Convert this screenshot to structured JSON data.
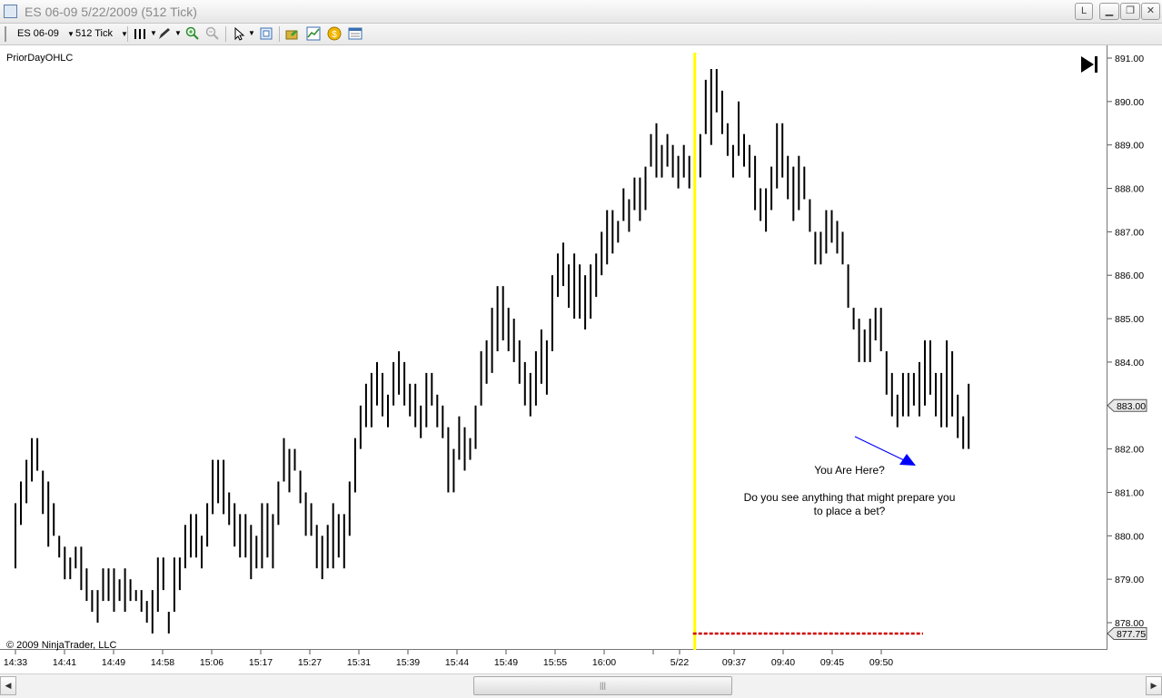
{
  "window": {
    "title": "ES 06-09  5/22/2009 (512 Tick)",
    "buttons": {
      "layout": "L",
      "minimize": "▁",
      "restore": "❐",
      "close": "✕"
    }
  },
  "toolbar": {
    "instrument": "ES 06-09",
    "interval": "512 Tick",
    "icons": [
      "bars-style-icon",
      "drawing-pencil-icon",
      "zoom-in-icon",
      "zoom-out-icon",
      "pointer-cursor-icon",
      "chart-properties-icon",
      "instrument-folder-icon",
      "indicators-icon",
      "strategies-icon",
      "data-box-icon"
    ]
  },
  "chart": {
    "indicator_label": "PriorDayOHLC",
    "copyright": "© 2009 NinjaTrader, LLC",
    "annotation_question": "You Are Here?",
    "annotation_line1": "Do you see anything that might prepare you",
    "annotation_line2": "to place a bet?",
    "last_price_label": "883.00",
    "prior_low_label": "877.75",
    "colors": {
      "bars": "#000000",
      "session_line": "#ffff00",
      "prior_low_line": "#cc0000",
      "arrow": "#0000ff"
    }
  },
  "chart_data": {
    "type": "ohlc-bars",
    "y_axis": {
      "min": 877.75,
      "max": 891.0,
      "ticks": [
        "878.00",
        "879.00",
        "880.00",
        "881.00",
        "882.00",
        "883.00",
        "884.00",
        "885.00",
        "886.00",
        "887.00",
        "888.00",
        "889.00",
        "890.00",
        "891.00"
      ]
    },
    "x_ticks": [
      "14:33",
      "14:41",
      "14:49",
      "14:58",
      "15:06",
      "15:17",
      "15:27",
      "15:31",
      "15:39",
      "15:44",
      "15:49",
      "15:55",
      "16:00",
      "5/22",
      "09:37",
      "09:40",
      "09:45",
      "09:50"
    ],
    "session_break_bar_index": 124,
    "prior_low": 877.75,
    "last_price": 883.0,
    "bars": [
      [
        879.25,
        880.75
      ],
      [
        880.25,
        881.25
      ],
      [
        880.75,
        881.75
      ],
      [
        881.25,
        882.25
      ],
      [
        881.5,
        882.25
      ],
      [
        880.5,
        881.5
      ],
      [
        879.75,
        881.25
      ],
      [
        880.0,
        880.75
      ],
      [
        879.5,
        880.0
      ],
      [
        879.0,
        879.75
      ],
      [
        879.0,
        879.5
      ],
      [
        879.25,
        879.75
      ],
      [
        878.75,
        879.75
      ],
      [
        878.5,
        879.25
      ],
      [
        878.25,
        878.75
      ],
      [
        878.0,
        878.75
      ],
      [
        878.5,
        879.25
      ],
      [
        878.5,
        879.25
      ],
      [
        878.25,
        879.25
      ],
      [
        878.5,
        879.0
      ],
      [
        878.25,
        879.25
      ],
      [
        878.5,
        879.0
      ],
      [
        878.5,
        878.75
      ],
      [
        878.25,
        878.75
      ],
      [
        878.0,
        878.5
      ],
      [
        877.75,
        878.75
      ],
      [
        878.25,
        879.5
      ],
      [
        878.75,
        879.5
      ],
      [
        877.75,
        878.25
      ],
      [
        878.25,
        879.5
      ],
      [
        878.75,
        879.5
      ],
      [
        879.25,
        880.25
      ],
      [
        879.5,
        880.5
      ],
      [
        879.5,
        880.5
      ],
      [
        879.25,
        880.0
      ],
      [
        879.75,
        880.75
      ],
      [
        880.5,
        881.75
      ],
      [
        880.75,
        881.75
      ],
      [
        880.5,
        881.75
      ],
      [
        880.25,
        881.0
      ],
      [
        879.75,
        880.75
      ],
      [
        879.5,
        880.5
      ],
      [
        879.5,
        880.5
      ],
      [
        879.0,
        880.25
      ],
      [
        879.25,
        880.0
      ],
      [
        879.25,
        880.75
      ],
      [
        879.5,
        880.75
      ],
      [
        879.25,
        880.5
      ],
      [
        880.25,
        881.25
      ],
      [
        881.25,
        882.25
      ],
      [
        881.0,
        882.0
      ],
      [
        881.5,
        882.0
      ],
      [
        880.75,
        881.5
      ],
      [
        880.0,
        881.0
      ],
      [
        880.0,
        880.75
      ],
      [
        879.25,
        880.25
      ],
      [
        879.0,
        880.0
      ],
      [
        879.25,
        880.25
      ],
      [
        879.25,
        880.75
      ],
      [
        879.5,
        880.5
      ],
      [
        879.25,
        880.5
      ],
      [
        880.0,
        881.25
      ],
      [
        881.0,
        882.25
      ],
      [
        882.0,
        883.0
      ],
      [
        882.5,
        883.5
      ],
      [
        882.5,
        883.75
      ],
      [
        883.0,
        884.0
      ],
      [
        882.75,
        883.75
      ],
      [
        882.5,
        883.25
      ],
      [
        883.0,
        884.0
      ],
      [
        883.25,
        884.25
      ],
      [
        883.0,
        884.0
      ],
      [
        882.75,
        883.5
      ],
      [
        882.5,
        883.5
      ],
      [
        882.25,
        883.0
      ],
      [
        882.5,
        883.75
      ],
      [
        883.0,
        883.75
      ],
      [
        882.5,
        883.25
      ],
      [
        882.25,
        883.0
      ],
      [
        881.0,
        882.5
      ],
      [
        881.0,
        882.0
      ],
      [
        881.75,
        882.75
      ],
      [
        881.5,
        882.5
      ],
      [
        881.75,
        882.25
      ],
      [
        882.0,
        883.0
      ],
      [
        883.0,
        884.25
      ],
      [
        883.5,
        884.5
      ],
      [
        883.75,
        885.25
      ],
      [
        884.25,
        885.75
      ],
      [
        884.5,
        885.75
      ],
      [
        884.25,
        885.25
      ],
      [
        884.0,
        885.0
      ],
      [
        883.5,
        884.5
      ],
      [
        883.0,
        884.0
      ],
      [
        882.75,
        883.75
      ],
      [
        883.0,
        884.25
      ],
      [
        883.5,
        884.75
      ],
      [
        883.25,
        884.5
      ],
      [
        884.25,
        886.0
      ],
      [
        885.5,
        886.5
      ],
      [
        885.75,
        886.75
      ],
      [
        885.25,
        886.25
      ],
      [
        885.0,
        886.5
      ],
      [
        885.0,
        886.25
      ],
      [
        884.75,
        886.0
      ],
      [
        885.0,
        886.25
      ],
      [
        885.5,
        886.5
      ],
      [
        886.0,
        887.0
      ],
      [
        886.25,
        887.5
      ],
      [
        886.5,
        887.5
      ],
      [
        886.75,
        887.25
      ],
      [
        887.25,
        888.0
      ],
      [
        887.0,
        887.75
      ],
      [
        887.5,
        888.25
      ],
      [
        887.25,
        888.25
      ],
      [
        887.5,
        888.5
      ],
      [
        888.5,
        889.25
      ],
      [
        888.25,
        889.5
      ],
      [
        888.25,
        889.0
      ],
      [
        888.5,
        889.25
      ],
      [
        888.25,
        889.0
      ],
      [
        888.0,
        888.75
      ],
      [
        888.25,
        889.0
      ],
      [
        888.0,
        888.75
      ],
      [
        888.5,
        889.0
      ],
      [
        888.25,
        889.25
      ],
      [
        889.25,
        890.5
      ],
      [
        889.0,
        890.75
      ],
      [
        889.75,
        890.75
      ],
      [
        889.25,
        890.25
      ],
      [
        888.75,
        889.5
      ],
      [
        888.25,
        889.0
      ],
      [
        888.75,
        890.0
      ],
      [
        888.5,
        889.25
      ],
      [
        888.25,
        889.0
      ],
      [
        887.5,
        888.75
      ],
      [
        887.25,
        888.0
      ],
      [
        887.0,
        888.0
      ],
      [
        887.5,
        888.5
      ],
      [
        888.0,
        889.5
      ],
      [
        888.25,
        889.5
      ],
      [
        887.75,
        888.75
      ],
      [
        887.25,
        888.5
      ],
      [
        887.5,
        888.75
      ],
      [
        887.75,
        888.5
      ],
      [
        887.0,
        887.75
      ],
      [
        886.25,
        887.0
      ],
      [
        886.25,
        887.0
      ],
      [
        886.5,
        887.5
      ],
      [
        886.75,
        887.5
      ],
      [
        886.5,
        887.25
      ],
      [
        886.25,
        887.0
      ],
      [
        885.25,
        886.25
      ],
      [
        884.75,
        885.25
      ],
      [
        884.0,
        885.0
      ],
      [
        884.0,
        884.75
      ],
      [
        884.0,
        885.0
      ],
      [
        884.5,
        885.25
      ],
      [
        884.25,
        885.25
      ],
      [
        883.25,
        884.25
      ],
      [
        882.75,
        883.75
      ],
      [
        882.5,
        883.25
      ],
      [
        882.75,
        883.75
      ],
      [
        882.75,
        883.75
      ],
      [
        883.0,
        883.75
      ],
      [
        882.75,
        884.0
      ],
      [
        883.0,
        884.5
      ],
      [
        883.25,
        884.5
      ],
      [
        882.75,
        883.75
      ],
      [
        882.5,
        883.75
      ],
      [
        882.5,
        884.5
      ],
      [
        882.75,
        884.25
      ],
      [
        882.25,
        883.25
      ],
      [
        882.0,
        882.75
      ],
      [
        882.0,
        883.5
      ]
    ]
  }
}
